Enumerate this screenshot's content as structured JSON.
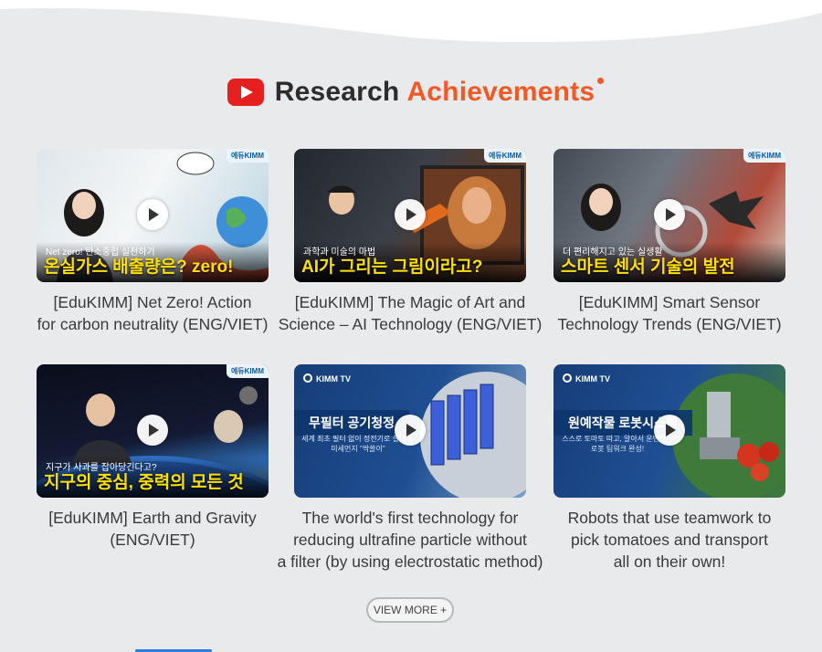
{
  "header": {
    "title_part1": "Research",
    "title_part2": "Achievements"
  },
  "colors": {
    "accent": "#f15a24",
    "youtube_red": "#e61f1f",
    "background": "#e9eaec"
  },
  "videos": [
    {
      "badge": "에듀KIMM",
      "thumb_small": "Net zero! 탄소중립 실천하기",
      "thumb_big": "온실가스 배출량은? zero!",
      "caption_line1": "[EduKIMM] Net Zero! Action",
      "caption_line2": "for carbon neutrality (ENG/VIET)"
    },
    {
      "badge": "에듀KIMM",
      "thumb_small": "과학과 미술의 마법",
      "thumb_big": "AI가 그리는 그림이라고?",
      "caption_line1": "[EduKIMM] The Magic of Art and",
      "caption_line2": "Science – AI Technology (ENG/VIET)"
    },
    {
      "badge": "에듀KIMM",
      "thumb_small": "더 편리해지고 있는 실생활",
      "thumb_big": "스마트 센서 기술의 발전",
      "caption_line1": "[EduKIMM] Smart Sensor",
      "caption_line2": "Technology Trends (ENG/VIET)"
    },
    {
      "badge": "에듀KIMM",
      "thumb_small": "지구가 사과를 잡아당긴다고?",
      "thumb_big": "지구의 중심, 중력의 모든 것",
      "caption_line1": "[EduKIMM] Earth and Gravity",
      "caption_line2": "(ENG/VIET)"
    },
    {
      "channel": "KIMM TV",
      "thumb_title": "무필터 공기청정",
      "thumb_sub": "세계 최초 필터 없이 정전기로 실내 초미세먼지 \"싹쓸이\"",
      "caption_line1": "The world's first technology for",
      "caption_line2": "reducing ultrafine particle without",
      "caption_line3": "a filter (by using electrostatic method)"
    },
    {
      "channel": "KIMM TV",
      "thumb_title": "원예작물 로봇시스템",
      "thumb_sub": "스스로 토마토 따고, 알아서 운반하는 로봇 팀워크 완성!",
      "caption_line1": "Robots that use teamwork to",
      "caption_line2": "pick tomatoes and transport",
      "caption_line3": "all on their own!"
    }
  ],
  "view_more_label": "VIEW MORE +"
}
